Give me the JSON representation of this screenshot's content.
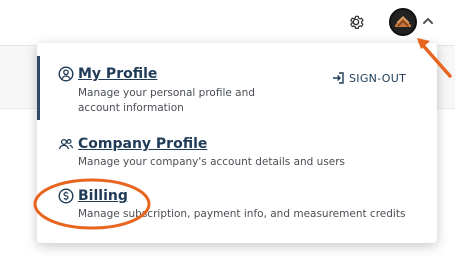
{
  "header": {
    "settings_icon": "gear-icon",
    "avatar_icon": "user-avatar",
    "menu_toggle_icon": "chevron-up-icon"
  },
  "menu": {
    "items": [
      {
        "icon": "user-circle-icon",
        "title": "My Profile",
        "description": "Manage your personal profile and account information"
      },
      {
        "icon": "users-icon",
        "title": "Company Profile",
        "description": "Manage your company's account details and users"
      },
      {
        "icon": "dollar-circle-icon",
        "title": "Billing",
        "description": "Manage subscription, payment info, and measurement credits"
      }
    ],
    "signout_label": "SIGN-OUT",
    "signout_icon": "signout-icon"
  },
  "colors": {
    "accent": "#1f3b57",
    "annotation": "#e8651f"
  }
}
